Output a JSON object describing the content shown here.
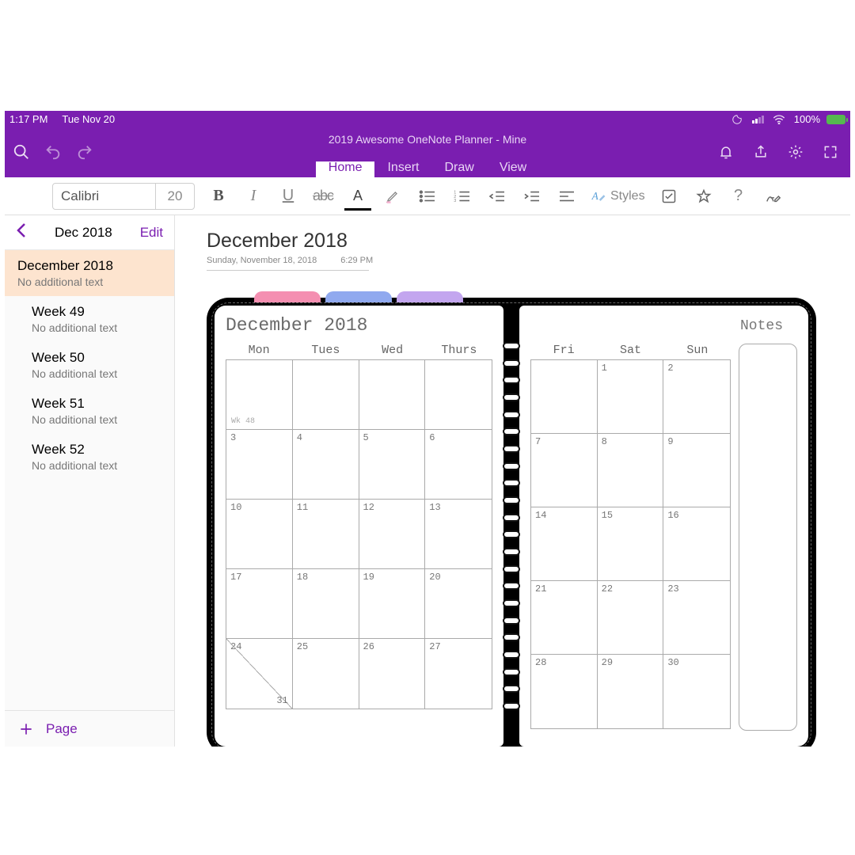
{
  "status": {
    "time": "1:17 PM",
    "date": "Tue Nov 20",
    "battery_pct": "100%"
  },
  "header": {
    "document_title": "2019 Awesome OneNote Planner - Mine",
    "tabs": [
      "Home",
      "Insert",
      "Draw",
      "View"
    ],
    "active_tab": "Home"
  },
  "ribbon": {
    "font_name": "Calibri",
    "font_size": "20",
    "styles_label": "Styles"
  },
  "sidebar": {
    "section_title": "Dec 2018",
    "edit_label": "Edit",
    "add_page_label": "Page",
    "subtext": "No additional text",
    "pages": [
      {
        "title": "December 2018",
        "selected": true,
        "child": false
      },
      {
        "title": "Week 49",
        "selected": false,
        "child": true
      },
      {
        "title": "Week 50",
        "selected": false,
        "child": true
      },
      {
        "title": "Week 51",
        "selected": false,
        "child": true
      },
      {
        "title": "Week 52",
        "selected": false,
        "child": true
      }
    ]
  },
  "page": {
    "title": "December 2018",
    "meta_date": "Sunday, November 18, 2018",
    "meta_time": "6:29 PM"
  },
  "planner": {
    "month_label": "December 2018",
    "notes_label": "Notes",
    "tab_colors": [
      "#f48fb1",
      "#90a9ef",
      "#c3a6ef"
    ],
    "left_days": [
      "Mon",
      "Tues",
      "Wed",
      "Thurs"
    ],
    "right_days": [
      "Fri",
      "Sat",
      "Sun"
    ],
    "first_week_label": "Wk 48",
    "left_grid": [
      [
        "",
        "",
        "",
        ""
      ],
      [
        "3",
        "4",
        "5",
        "6"
      ],
      [
        "10",
        "11",
        "12",
        "13"
      ],
      [
        "17",
        "18",
        "19",
        "20"
      ],
      [
        "24",
        "25",
        "26",
        "27"
      ]
    ],
    "right_grid": [
      [
        "",
        "1",
        "2"
      ],
      [
        "7",
        "8",
        "9"
      ],
      [
        "14",
        "15",
        "16"
      ],
      [
        "21",
        "22",
        "23"
      ],
      [
        "28",
        "29",
        "30"
      ]
    ],
    "overflow_day": "31"
  }
}
